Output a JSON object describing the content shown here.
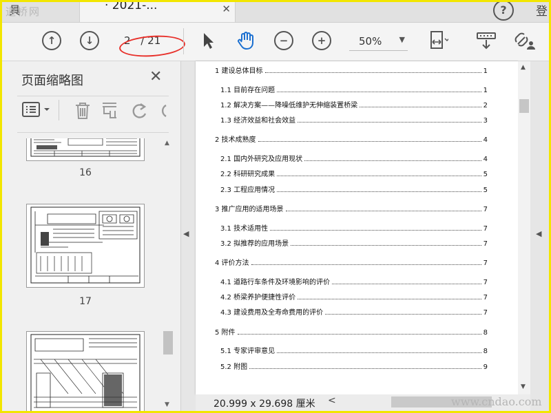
{
  "tabs": {
    "left_label": "具",
    "doc_title": "· 2021-...",
    "close": "✕",
    "help": "?",
    "login": "登"
  },
  "toolbar": {
    "page_current": "2",
    "page_total": "/ 21",
    "zoom": "50%",
    "icons": [
      "prev-page-icon",
      "next-page-icon",
      "select-cursor-icon",
      "hand-icon",
      "zoom-out-icon",
      "zoom-in-icon",
      "fit-width-icon",
      "scroll-mode-icon",
      "share-link-icon"
    ]
  },
  "panel": {
    "title": "页面缩略图",
    "close": "✕",
    "thumbnails": [
      {
        "label": "16"
      },
      {
        "label": "17"
      },
      {
        "label": ""
      }
    ]
  },
  "document": {
    "toc": [
      {
        "text": "1 建设总体目标",
        "page": "1",
        "level": 1
      },
      {
        "text": "1.1 目前存在问题",
        "page": "1",
        "level": 2
      },
      {
        "text": "1.2 解决方案——降噪低维护无伸缩装置桥梁",
        "page": "2",
        "level": 2
      },
      {
        "text": "1.3 经济效益和社会效益",
        "page": "3",
        "level": 2
      },
      {
        "text": "2 技术成熟度",
        "page": "4",
        "level": 1
      },
      {
        "text": "2.1 国内外研究及应用现状",
        "page": "4",
        "level": 2
      },
      {
        "text": "2.2 科研研究成果",
        "page": "5",
        "level": 2
      },
      {
        "text": "2.3 工程应用情况",
        "page": "5",
        "level": 2
      },
      {
        "text": "3 推广应用的适用场景",
        "page": "7",
        "level": 1
      },
      {
        "text": "3.1 技术适用性",
        "page": "7",
        "level": 2
      },
      {
        "text": "3.2 拟推荐的应用场景",
        "page": "7",
        "level": 2
      },
      {
        "text": "4 评价方法",
        "page": "7",
        "level": 1
      },
      {
        "text": "4.1 道路行车条件及环境影响的评价",
        "page": "7",
        "level": 2
      },
      {
        "text": "4.2 桥梁养护便捷性评价",
        "page": "7",
        "level": 2
      },
      {
        "text": "4.3 建设费用及全寿命费用的评价",
        "page": "7",
        "level": 2
      },
      {
        "text": "5 附件",
        "page": "8",
        "level": 1
      },
      {
        "text": "5.1 专家评审意见",
        "page": "8",
        "level": 2
      },
      {
        "text": "5.2 附图",
        "page": "9",
        "level": 2
      }
    ]
  },
  "status": {
    "dimensions": "20.999 x 29.698 厘米"
  },
  "watermarks": {
    "top_left": "道桥网",
    "bottom_right": "www.cndao.com"
  }
}
